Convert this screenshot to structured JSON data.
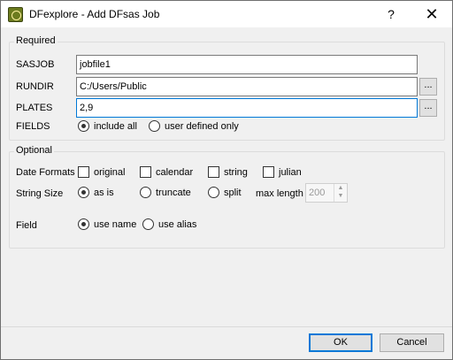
{
  "window": {
    "title": "DFexplore - Add DFsas Job",
    "help_glyph": "?",
    "close_glyph": "✕"
  },
  "required": {
    "legend": "Required",
    "sasjob": {
      "label": "SASJOB",
      "value": "jobfile1"
    },
    "rundir": {
      "label": "RUNDIR",
      "value": "C:/Users/Public",
      "browse": "..."
    },
    "plates": {
      "label": "PLATES",
      "value": "2,9",
      "browse": "..."
    },
    "fields": {
      "label": "FIELDS",
      "options": [
        {
          "label": "include all",
          "selected": true
        },
        {
          "label": "user defined only",
          "selected": false
        }
      ]
    }
  },
  "optional": {
    "legend": "Optional",
    "date_formats": {
      "label": "Date Formats",
      "options": [
        {
          "label": "original",
          "checked": false
        },
        {
          "label": "calendar",
          "checked": false
        },
        {
          "label": "string",
          "checked": false
        },
        {
          "label": "julian",
          "checked": false
        }
      ]
    },
    "string_size": {
      "label": "String Size",
      "options": [
        {
          "label": "as is",
          "selected": true
        },
        {
          "label": "truncate",
          "selected": false
        },
        {
          "label": "split",
          "selected": false
        }
      ],
      "max_length_label": "max length",
      "max_length_value": "200"
    },
    "field": {
      "label": "Field",
      "options": [
        {
          "label": "use name",
          "selected": true
        },
        {
          "label": "use alias",
          "selected": false
        }
      ]
    }
  },
  "buttons": {
    "ok": "OK",
    "cancel": "Cancel"
  }
}
